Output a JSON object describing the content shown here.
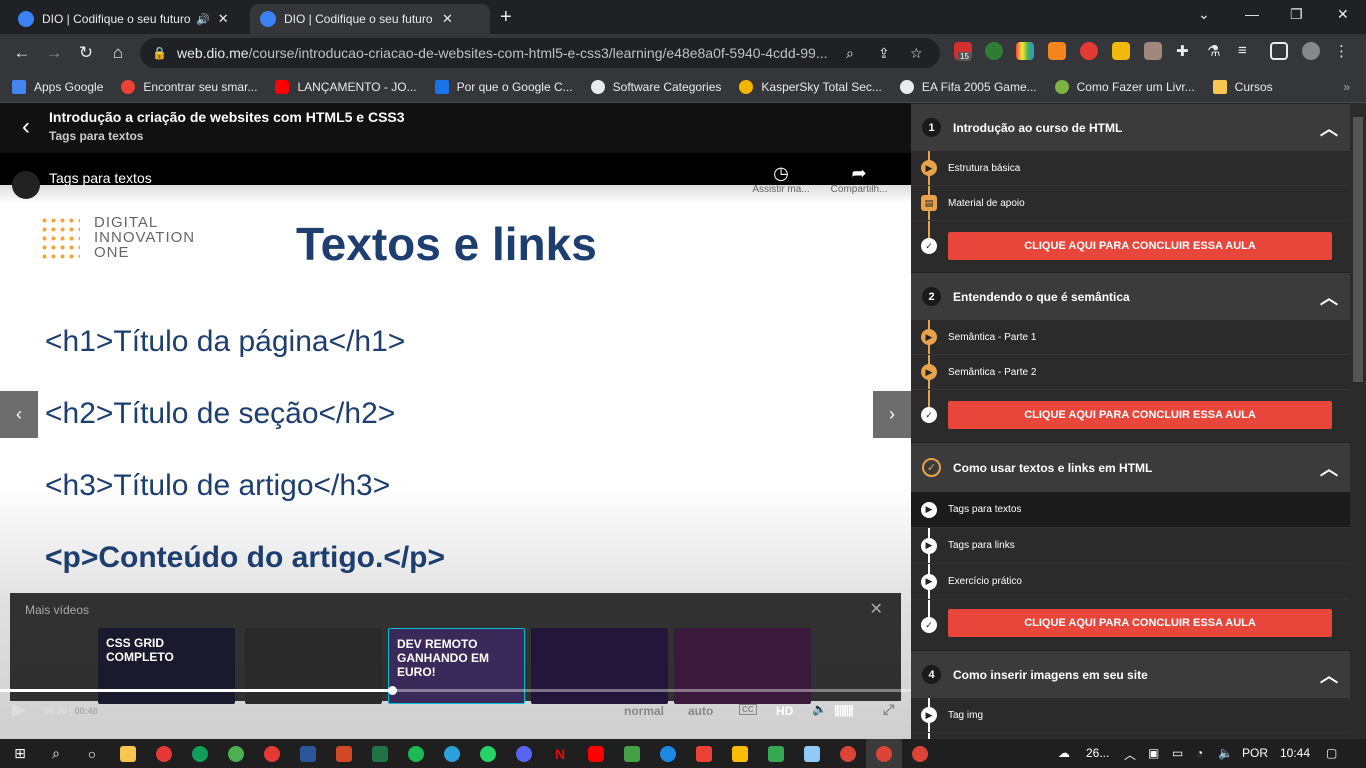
{
  "browser": {
    "tabs": [
      {
        "title": "DIO | Codifique o seu futuro"
      },
      {
        "title": "DIO | Codifique o seu futuro glob"
      }
    ],
    "url_host": "web.dio.me",
    "url_path": "/course/introducao-criacao-de-websites-com-html5-e-css3/learning/e48e8a0f-5940-4cdd-99...",
    "bookmarks": [
      {
        "label": "Apps Google",
        "color": "#4285f4"
      },
      {
        "label": "Encontrar seu smar...",
        "color": "#ea4335"
      },
      {
        "label": "LANÇAMENTO - JO...",
        "color": "#ff0000"
      },
      {
        "label": "Por que o Google C...",
        "color": "#1a73e8"
      },
      {
        "label": "Software Categories",
        "color": "#e8eaed"
      },
      {
        "label": "KasperSky Total Sec...",
        "color": "#f4b400"
      },
      {
        "label": "EA Fifa 2005 Game...",
        "color": "#e8eaed"
      },
      {
        "label": "Como Fazer um Livr...",
        "color": "#7cb342"
      },
      {
        "label": "Cursos",
        "color": "#f9c74f"
      }
    ],
    "ext_badge": "15"
  },
  "course": {
    "title": "Introdução a criação de websites com HTML5 e CSS3",
    "subtitle": "Tags para textos"
  },
  "player": {
    "video_title": "Tags para textos",
    "watch_later": "Assistir ma...",
    "share": "Compartilh...",
    "slide": {
      "logo_line1": "DIGITAL",
      "logo_line2": "INNOVATION",
      "logo_line3": "ONE",
      "title": "Textos e links",
      "lines": [
        "<h1>Título da página</h1>",
        "<h2>Título de seção</h2>",
        "<h3>Título de artigo</h3>",
        "<p>Conteúdo do artigo.</p>"
      ]
    },
    "more_videos": "Mais vídeos",
    "thumbnails": [
      {
        "text": "CSS GRID COMPLETO",
        "color": "#1a1a2e"
      },
      {
        "text": "",
        "color": "#2a2a2a"
      },
      {
        "text": "DEV REMOTO GANHANDO EM EURO!",
        "color": "#3a2a5a"
      },
      {
        "text": "",
        "color": "#22163a"
      },
      {
        "text": "",
        "color": "#3a1a3a"
      }
    ],
    "time_current": "00:20",
    "time_total": "00:48",
    "speed": "normal",
    "quality": "auto",
    "hd": "HD",
    "progress": 0.43
  },
  "sidebar": {
    "sections": [
      {
        "num": "1",
        "title": "Introdução ao curso de HTML",
        "items": [
          "Estrutura básica",
          "Material de apoio"
        ],
        "button": "CLIQUE AQUI PARA CONCLUIR ESSA AULA"
      },
      {
        "num": "2",
        "title": "Entendendo o que é semântica",
        "items": [
          "Semântica - Parte 1",
          "Semântica - Parte 2"
        ],
        "button": "CLIQUE AQUI PARA CONCLUIR ESSA AULA"
      },
      {
        "num": "",
        "title": "Como usar textos e links em HTML",
        "items": [
          "Tags para textos",
          "Tags para links",
          "Exercício prático"
        ],
        "button": "CLIQUE AQUI PARA CONCLUIR ESSA AULA"
      },
      {
        "num": "4",
        "title": "Como inserir imagens em seu site",
        "items": [
          "Tag img"
        ],
        "button": ""
      }
    ]
  },
  "taskbar": {
    "weather": "26...",
    "lang": "POR",
    "time": "10:44"
  }
}
